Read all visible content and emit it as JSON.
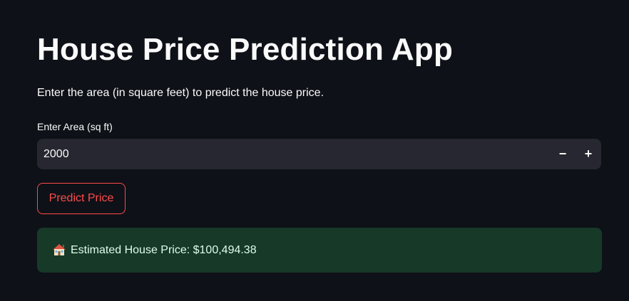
{
  "app": {
    "title": "House Price Prediction App",
    "subtitle": "Enter the area (in square feet) to predict the house price."
  },
  "area_input": {
    "label": "Enter Area (sq ft)",
    "value": "2000",
    "decrement_label": "−",
    "increment_label": "+"
  },
  "predict_button": {
    "label": "Predict Price"
  },
  "result": {
    "icon": "house-icon",
    "text": "Estimated House Price: $100,494.38"
  },
  "colors": {
    "background": "#0e1117",
    "input_background": "#262730",
    "accent": "#ff4b4b",
    "success_background": "#173928",
    "success_text": "#dffde9"
  }
}
